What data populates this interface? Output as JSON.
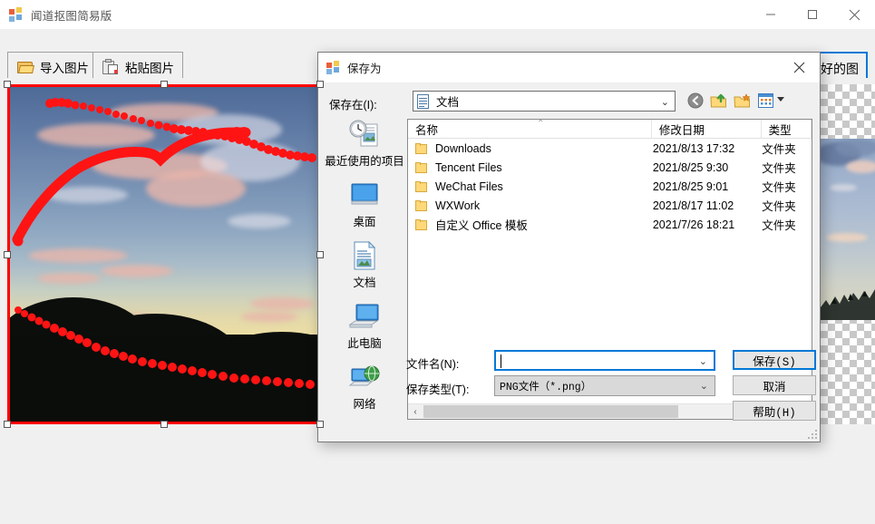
{
  "app": {
    "title": "闻道抠图简易版",
    "icon": "app-logo-icon",
    "window_controls": {
      "minimize": "minimize-icon",
      "maximize": "maximize-icon",
      "close": "close-icon"
    }
  },
  "toolbar": {
    "import_label": "导入图片",
    "import_icon": "open-folder-icon",
    "paste_label": "粘贴图片",
    "paste_icon": "paste-clipboard-icon",
    "save_cut_label": "抠好的图"
  },
  "canvas": {
    "selection_color": "#ff0000",
    "handles": 8,
    "checkerboard_light": "#ffffff",
    "checkerboard_dark": "#c8c8c8"
  },
  "dialog": {
    "title": "保存为",
    "icon": "app-logo-icon",
    "close_label": "×",
    "lookin": {
      "label": "保存在(I):",
      "value": "文档",
      "icon": "documents-icon",
      "caret": "⌄"
    },
    "tools": {
      "back": "back-arrow-icon",
      "up": "up-one-level-icon",
      "new_folder": "new-folder-icon",
      "views": "views-grid-icon"
    },
    "places": [
      {
        "label": "最近使用的项目",
        "icon": "recent-items-icon"
      },
      {
        "label": "桌面",
        "icon": "desktop-icon"
      },
      {
        "label": "文档",
        "icon": "documents-icon"
      },
      {
        "label": "此电脑",
        "icon": "this-pc-icon"
      },
      {
        "label": "网络",
        "icon": "network-icon"
      }
    ],
    "filelist": {
      "columns": [
        "名称",
        "修改日期",
        "类型"
      ],
      "sort_indicator": "⌃",
      "rows": [
        {
          "name": "Downloads",
          "date": "2021/8/13 17:32",
          "type": "文件夹"
        },
        {
          "name": "Tencent Files",
          "date": "2021/8/25 9:30",
          "type": "文件夹"
        },
        {
          "name": "WeChat Files",
          "date": "2021/8/25 9:01",
          "type": "文件夹"
        },
        {
          "name": "WXWork",
          "date": "2021/8/17 11:02",
          "type": "文件夹"
        },
        {
          "name": "自定义 Office 模板",
          "date": "2021/7/26 18:21",
          "type": "文件夹"
        }
      ],
      "hscroll_left": "‹",
      "hscroll_right": "›"
    },
    "filename": {
      "label": "文件名(N):",
      "value": "",
      "placeholder": "",
      "caret": "⌄"
    },
    "filetype": {
      "label": "保存类型(T):",
      "value": "PNG文件（*.png）",
      "caret": "⌄"
    },
    "buttons": {
      "save": "保存(S)",
      "cancel": "取消",
      "help": "帮助(H)"
    },
    "accent_color": "#0078d7"
  }
}
